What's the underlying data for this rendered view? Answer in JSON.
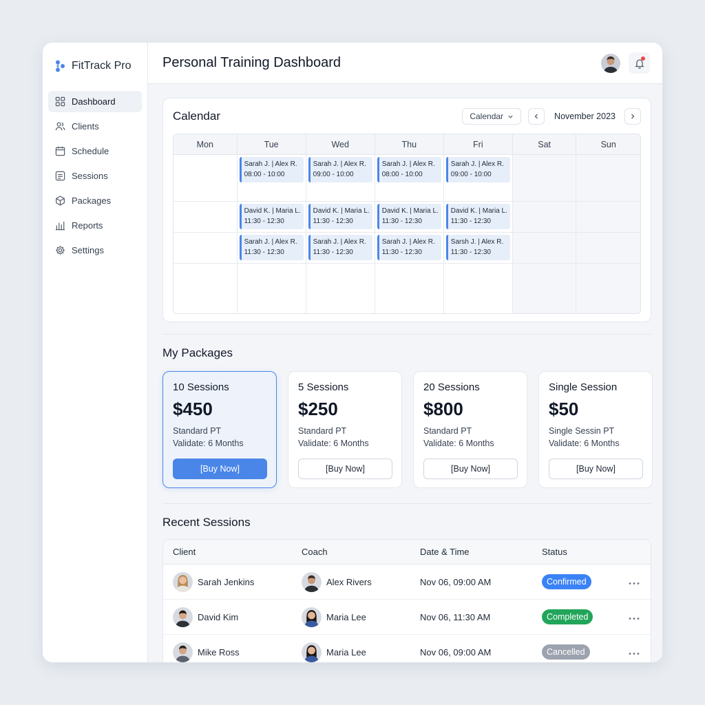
{
  "app": {
    "name": "FitTrack Pro"
  },
  "colors": {
    "accent": "#4a86e8",
    "confirmed": "#3b82f6",
    "completed": "#22a55a",
    "cancelled": "#9ca3af"
  },
  "sidebar": {
    "items": [
      {
        "label": "Dashboard",
        "icon": "dashboard-icon",
        "active": true
      },
      {
        "label": "Clients",
        "icon": "users-icon"
      },
      {
        "label": "Schedule",
        "icon": "calendar-icon"
      },
      {
        "label": "Sessions",
        "icon": "sessions-icon"
      },
      {
        "label": "Packages",
        "icon": "package-icon"
      },
      {
        "label": "Reports",
        "icon": "bar-chart-icon"
      },
      {
        "label": "Settings",
        "icon": "gear-icon"
      }
    ]
  },
  "header": {
    "title": "Personal Training Dashboard"
  },
  "calendar": {
    "title": "Calendar",
    "view_select": "Calendar",
    "month": "November 2023",
    "days": [
      "Mon",
      "Tue",
      "Wed",
      "Thu",
      "Fri",
      "Sat",
      "Sun"
    ],
    "rows": [
      [
        null,
        {
          "name": "Sarah J. | Alex R.",
          "time": "08:00 - 10:00"
        },
        {
          "name": "Sarah J. | Alex R.",
          "time": "09:00 - 10:00"
        },
        {
          "name": "Sarah J. | Alex R.",
          "time": "08:00 - 10:00"
        },
        {
          "name": "Sarah J. | Alex R.",
          "time": "09:00 - 10:00"
        },
        null,
        null
      ],
      [
        null,
        {
          "name": "David K. | Maria L.",
          "time": "11:30 - 12:30"
        },
        {
          "name": "David K. | Maria L.",
          "time": "11:30 - 12:30"
        },
        {
          "name": "David K. | Maria L.",
          "time": "11:30 - 12:30"
        },
        {
          "name": "David K. | Maria L.",
          "time": "11:30 - 12:30"
        },
        null,
        null
      ],
      [
        null,
        {
          "name": "Sarah J. | Alex R.",
          "time": "11:30 - 12:30"
        },
        {
          "name": "Sarah J. | Alex R.",
          "time": "11:30 - 12:30"
        },
        {
          "name": "Sarah J. | Alex R.",
          "time": "11:30 - 12:30"
        },
        {
          "name": "Sarsh J. | Alex R.",
          "time": "11:30 - 12:30"
        },
        null,
        null
      ],
      [
        null,
        null,
        null,
        null,
        null,
        null,
        null
      ]
    ]
  },
  "packages": {
    "title": "My Packages",
    "items": [
      {
        "name": "10 Sessions",
        "price": "$450",
        "type": "Standard PT",
        "validity": "Validate: 6 Months",
        "button": "[Buy Now]",
        "featured": true
      },
      {
        "name": "5 Sessions",
        "price": "$250",
        "type": "Standard PT",
        "validity": "Validate: 6 Months",
        "button": "[Buy Now]"
      },
      {
        "name": "20 Sessions",
        "price": "$800",
        "type": "Standard PT",
        "validity": "Validate: 6 Months",
        "button": "[Buy Now]"
      },
      {
        "name": "Single Session",
        "price": "$50",
        "type": "Single Sessin PT",
        "validity": "Validate: 6 Months",
        "button": "[Buy Now]"
      }
    ]
  },
  "recent_sessions": {
    "title": "Recent Sessions",
    "columns": [
      "Client",
      "Coach",
      "Date & Time",
      "Status"
    ],
    "rows": [
      {
        "client": "Sarah Jenkins",
        "coach": "Alex Rivers",
        "datetime": "Nov 06, 09:00 AM",
        "status": "Confirmed"
      },
      {
        "client": "David Kim",
        "coach": "Maria Lee",
        "datetime": "Nov 06, 11:30 AM",
        "status": "Completed"
      },
      {
        "client": "Mike Ross",
        "coach": "Maria Lee",
        "datetime": "Nov 06, 09:00 AM",
        "status": "Cancelled"
      }
    ]
  }
}
